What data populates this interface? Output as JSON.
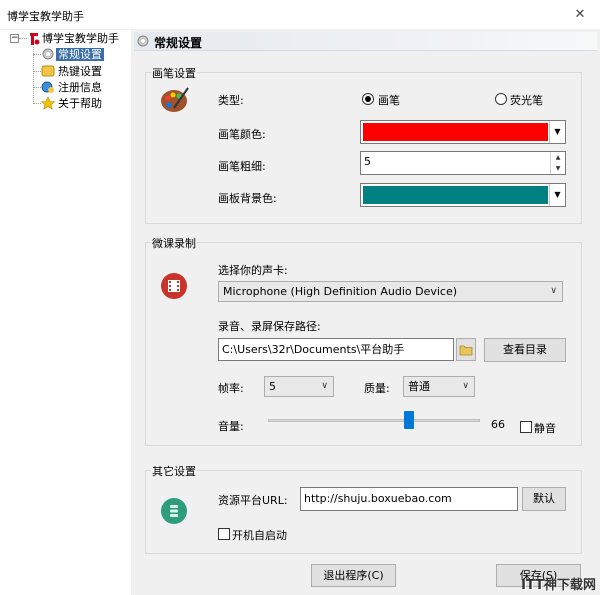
{
  "window": {
    "title": "博学宝教学助手",
    "close_glyph": "✕"
  },
  "tree": {
    "root": "博学宝教学助手",
    "items": [
      {
        "label": "常规设置",
        "icon": "gear-icon",
        "selected": true
      },
      {
        "label": "热键设置",
        "icon": "keyboard-icon",
        "selected": false
      },
      {
        "label": "注册信息",
        "icon": "globe-user-icon",
        "selected": false
      },
      {
        "label": "关于帮助",
        "icon": "star-icon",
        "selected": false
      }
    ]
  },
  "header": {
    "title": "常规设置"
  },
  "pen": {
    "group_title": "画笔设置",
    "type_label": "类型:",
    "type_options": [
      "画笔",
      "荧光笔"
    ],
    "type_selected": "画笔",
    "color_label": "画笔颜色:",
    "color_value": "#ff0000",
    "width_label": "画笔粗细:",
    "width_value": "5",
    "bg_label": "画板背景色:",
    "bg_value": "#008080"
  },
  "record": {
    "group_title": "微课录制",
    "soundcard_label": "选择你的声卡:",
    "soundcard_value": "Microphone (High Definition Audio Device)",
    "path_label": "录音、录屏保存路径:",
    "path_value": "C:\\Users\\32r\\Documents\\平台助手",
    "view_dir_button": "查看目录",
    "fps_label": "帧率:",
    "fps_value": "5",
    "quality_label": "质量:",
    "quality_value": "普通",
    "volume_label": "音量:",
    "volume_value": "66",
    "volume_fraction": 0.66,
    "mute_label": "静音",
    "mute_checked": false
  },
  "other": {
    "group_title": "其它设置",
    "url_label": "资源平台URL:",
    "url_value": "http://shuju.boxuebao.com",
    "default_button": "默认",
    "autostart_label": "开机自启动",
    "autostart_checked": false
  },
  "footer": {
    "exit_button": "退出程序(C)",
    "save_button": "保存(S)"
  },
  "watermark": "ITT神下载网"
}
